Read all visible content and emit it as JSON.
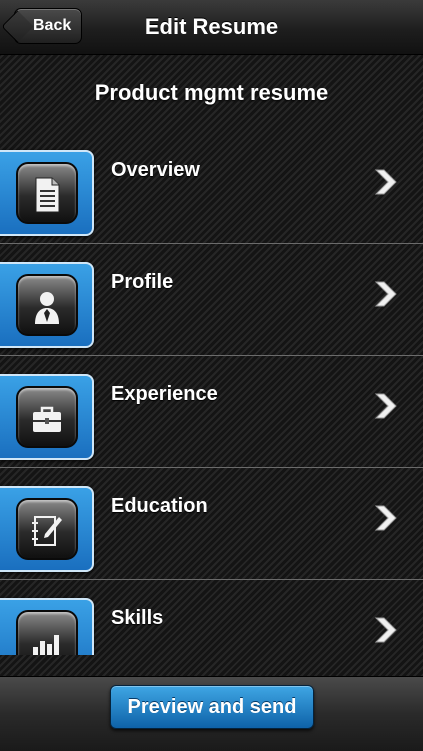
{
  "navbar": {
    "back_label": "Back",
    "title": "Edit Resume"
  },
  "resume_name": "Product mgmt resume",
  "sections": [
    {
      "label": "Overview",
      "icon": "document-icon"
    },
    {
      "label": "Profile",
      "icon": "person-icon"
    },
    {
      "label": "Experience",
      "icon": "briefcase-icon"
    },
    {
      "label": "Education",
      "icon": "notebook-pen-icon"
    },
    {
      "label": "Skills",
      "icon": "bar-chart-icon"
    }
  ],
  "footer": {
    "preview_label": "Preview and send"
  },
  "colors": {
    "accent_blue": "#1a6fbf",
    "background": "#1c1c1c",
    "text": "#ffffff"
  }
}
